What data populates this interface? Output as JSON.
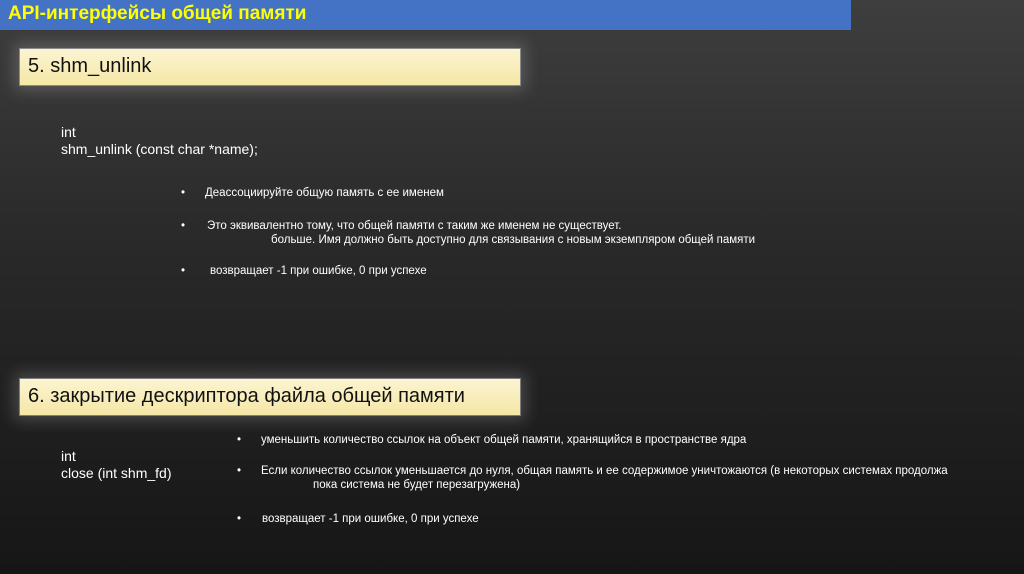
{
  "header": {
    "title": "API-интерфейсы общей памяти"
  },
  "section1": {
    "heading": "5. shm_unlink",
    "code_line1": "int",
    "code_line2": "shm_unlink (const char *name);",
    "bullets": [
      {
        "text": "Деассоциируйте общую память с ее именем"
      },
      {
        "text": "Это эквивалентно тому, что общей памяти с таким же именем не существует.",
        "cont": "больше. Имя должно быть доступно для связывания с новым экземпляром общей памяти"
      },
      {
        "text": "возвращает -1 при ошибке, 0 при успехе"
      }
    ]
  },
  "section2": {
    "heading": "6. закрытие дескриптора файла общей памяти",
    "code_line1": "int",
    "code_line2": "close (int shm_fd)",
    "bullets": [
      {
        "text": "уменьшить количество ссылок на объект общей памяти, хранящийся в пространстве ядра"
      },
      {
        "text": "Если количество ссылок уменьшается до нуля, общая память и ее содержимое уничтожаются (в некоторых системах продолжа",
        "cont": "пока система не будет перезагружена)"
      },
      {
        "text": "возвращает -1 при ошибке, 0 при успехе"
      }
    ]
  },
  "bullet_char": "•"
}
